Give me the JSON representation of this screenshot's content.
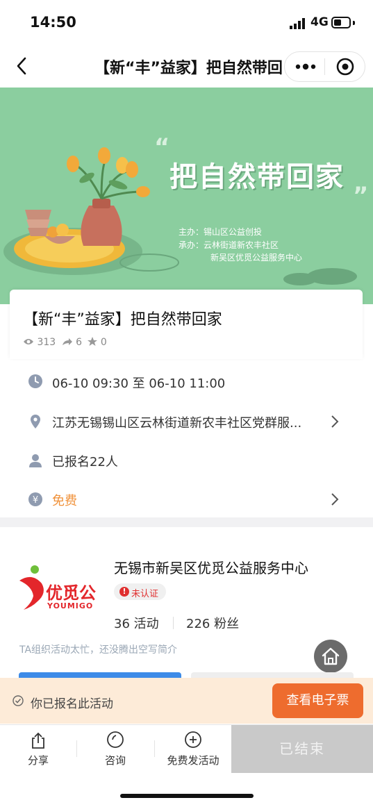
{
  "status_bar": {
    "time": "14:50",
    "network": "4G"
  },
  "nav": {
    "title": "【新“丰”益家】把自然带回家"
  },
  "banner": {
    "title": "把自然带回家",
    "organizers": [
      "主办：锡山区公益创投",
      "承办：云林街道新农丰社区",
      "新吴区优觅公益服务中心"
    ]
  },
  "event": {
    "title": "【新“丰”益家】把自然带回家",
    "views": "313",
    "shares": "6",
    "stars": "0"
  },
  "info": {
    "time": "06-10 09:30 至 06-10 11:00",
    "location": "江苏无锡锡山区云林街道新农丰社区党群服...",
    "registered": "已报名22人",
    "fee": "免费"
  },
  "org": {
    "logo_text": "优觅公",
    "logo_subtext": "YOUMIGO",
    "name": "无锡市新吴区优觅公益服务中心",
    "badge": "未认证",
    "activities": "36 活动",
    "fans": "226 粉丝",
    "intro": "TA组织活动太忙，还没腾出空写简介"
  },
  "registration": {
    "text": "你已报名此活动",
    "ticket_button": "查看电子票"
  },
  "bottom_bar": {
    "share": "分享",
    "consult": "咨询",
    "publish": "免费发活动",
    "ended": "已结束"
  },
  "colors": {
    "banner_green": "#8bce9f",
    "fee_orange": "#f0923b",
    "ticket_orange": "#ee6c2e",
    "reg_bar_bg": "#fdebd8",
    "unverified_red": "#e03030"
  }
}
